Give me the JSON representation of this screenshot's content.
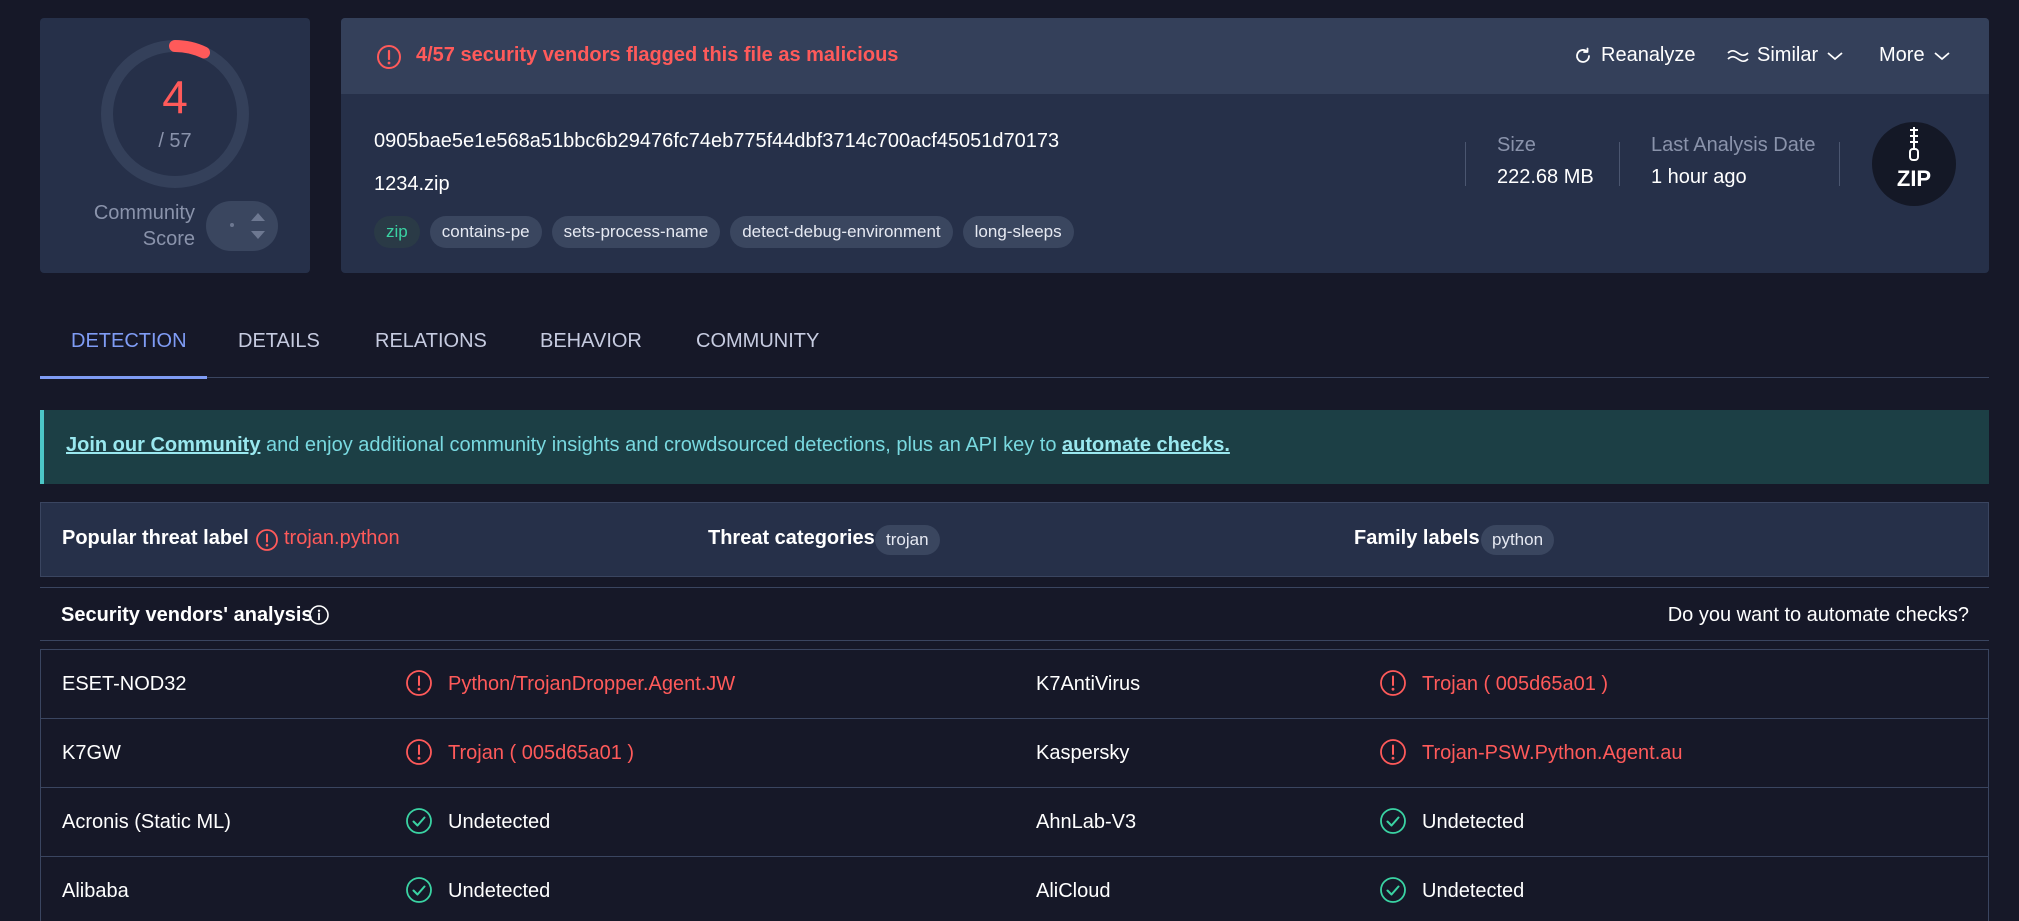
{
  "score": {
    "positives": "4",
    "total": "/ 57",
    "detection_fraction": 0.0702,
    "community_label_line1": "Community",
    "community_label_line2": "Score"
  },
  "file": {
    "alert_text": "4/57 security vendors flagged this file as malicious",
    "actions": {
      "reanalyze": "Reanalyze",
      "similar": "Similar",
      "more": "More"
    },
    "hash": "0905bae5e1e568a51bbc6b29476fc74eb775f44dbf3714c700acf45051d70173",
    "name": "1234.zip",
    "tags": [
      "zip",
      "contains-pe",
      "sets-process-name",
      "detect-debug-environment",
      "long-sleeps"
    ],
    "size_label": "Size",
    "size_value": "222.68 MB",
    "date_label": "Last Analysis Date",
    "date_value": "1 hour ago",
    "type_badge": "ZIP"
  },
  "tabs": [
    "DETECTION",
    "DETAILS",
    "RELATIONS",
    "BEHAVIOR",
    "COMMUNITY"
  ],
  "banner": {
    "link1": "Join our Community",
    "middle": " and enjoy additional community insights and crowdsourced detections, plus an API key to ",
    "link2": "automate checks."
  },
  "threat": {
    "popular_label": "Popular threat label",
    "popular_value": "trojan.python",
    "categories_label": "Threat categories",
    "categories_value": "trojan",
    "family_label": "Family labels",
    "family_value": "python"
  },
  "vendors_header": {
    "title": "Security vendors' analysis",
    "automate": "Do you want to automate checks?"
  },
  "vendors": [
    {
      "left_name": "ESET-NOD32",
      "left_result": "Python/TrojanDropper.Agent.JW",
      "left_status": "malicious",
      "right_name": "K7AntiVirus",
      "right_result": "Trojan ( 005d65a01 )",
      "right_status": "malicious"
    },
    {
      "left_name": "K7GW",
      "left_result": "Trojan ( 005d65a01 )",
      "left_status": "malicious",
      "right_name": "Kaspersky",
      "right_result": "Trojan-PSW.Python.Agent.au",
      "right_status": "malicious"
    },
    {
      "left_name": "Acronis (Static ML)",
      "left_result": "Undetected",
      "left_status": "undetected",
      "right_name": "AhnLab-V3",
      "right_result": "Undetected",
      "right_status": "undetected"
    },
    {
      "left_name": "Alibaba",
      "left_result": "Undetected",
      "left_status": "undetected",
      "right_name": "AliCloud",
      "right_result": "Undetected",
      "right_status": "undetected"
    }
  ],
  "colors": {
    "background": "#161828",
    "card": "#263049",
    "malicious": "#ff5a5a",
    "undetected": "#3ad3a3",
    "accent": "#7f9cf5",
    "banner": "#1c3f45"
  },
  "icons": {
    "alert": "exclamation-circle-icon",
    "reanalyze": "refresh-icon",
    "similar": "waves-icon",
    "chevron": "chevron-down-icon",
    "info": "info-circle-icon",
    "ok": "check-circle-icon",
    "file_type": "zip-file-icon"
  }
}
